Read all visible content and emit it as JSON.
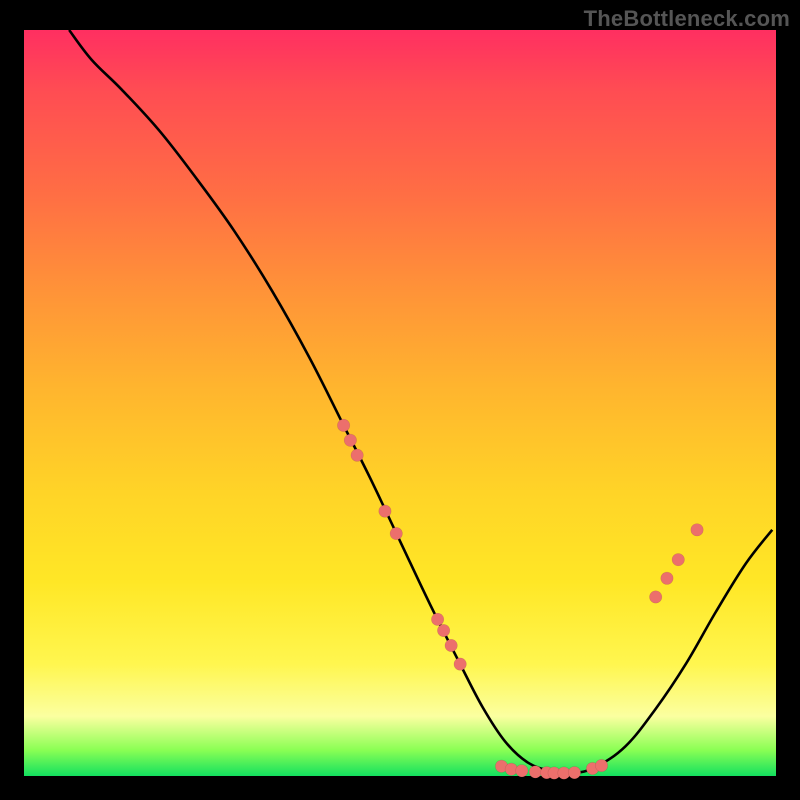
{
  "watermark": "TheBottleneck.com",
  "chart_data": {
    "type": "line",
    "title": "",
    "xlabel": "",
    "ylabel": "",
    "xlim": [
      0,
      100
    ],
    "ylim": [
      0,
      100
    ],
    "grid": false,
    "legend": "none",
    "series": [
      {
        "name": "curve",
        "x": [
          6,
          9,
          13,
          18,
          23,
          28,
          33,
          38,
          42.5,
          46,
          50,
          54,
          58,
          61,
          64,
          67,
          70,
          73,
          76,
          80,
          84,
          88,
          92,
          96,
          99.5
        ],
        "y": [
          100,
          96,
          92,
          86.5,
          80,
          73,
          65,
          56,
          47,
          40,
          31.5,
          23,
          15,
          9.2,
          4.6,
          1.8,
          0.7,
          0.4,
          1.2,
          4,
          9,
          15,
          22,
          28.5,
          33
        ]
      }
    ],
    "marker_points": {
      "name": "highlight-dots",
      "color": "#ec6f6c",
      "points": [
        {
          "x": 42.5,
          "y": 47
        },
        {
          "x": 43.4,
          "y": 45
        },
        {
          "x": 44.3,
          "y": 43
        },
        {
          "x": 48.0,
          "y": 35.5
        },
        {
          "x": 49.5,
          "y": 32.5
        },
        {
          "x": 55.0,
          "y": 21
        },
        {
          "x": 55.8,
          "y": 19.5
        },
        {
          "x": 56.8,
          "y": 17.5
        },
        {
          "x": 58.0,
          "y": 15
        },
        {
          "x": 63.5,
          "y": 1.3
        },
        {
          "x": 64.8,
          "y": 0.9
        },
        {
          "x": 66.2,
          "y": 0.7
        },
        {
          "x": 68.0,
          "y": 0.55
        },
        {
          "x": 69.5,
          "y": 0.45
        },
        {
          "x": 70.5,
          "y": 0.4
        },
        {
          "x": 71.8,
          "y": 0.4
        },
        {
          "x": 73.2,
          "y": 0.45
        },
        {
          "x": 75.6,
          "y": 1.0
        },
        {
          "x": 76.8,
          "y": 1.4
        },
        {
          "x": 84.0,
          "y": 24
        },
        {
          "x": 85.5,
          "y": 26.5
        },
        {
          "x": 87.0,
          "y": 29
        },
        {
          "x": 89.5,
          "y": 33
        }
      ]
    }
  }
}
